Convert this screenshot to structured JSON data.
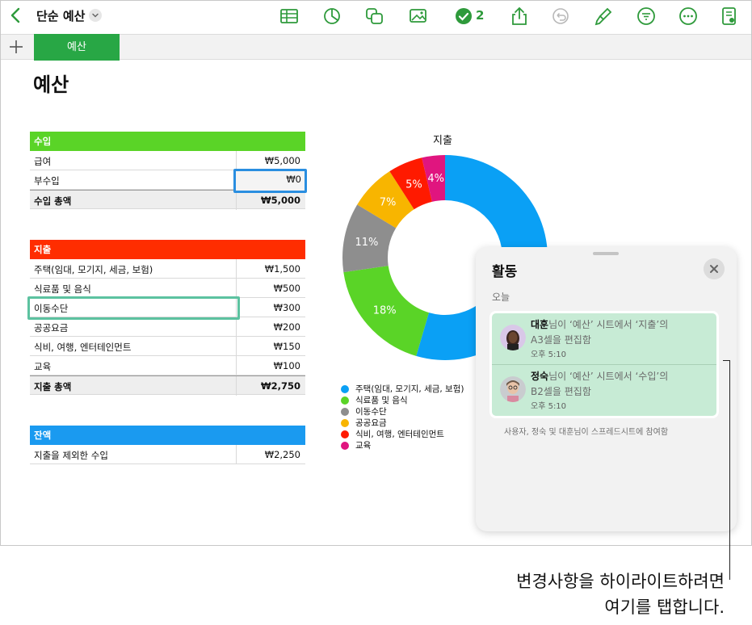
{
  "toolbar": {
    "doc_title": "단순 예산",
    "collab_count": "2"
  },
  "sheet_tabs": [
    {
      "label": "예산"
    }
  ],
  "page_title": "예산",
  "income_table": {
    "header": "수입",
    "header_color": "#5ad427",
    "rows": [
      {
        "label": "급여",
        "value": "₩5,000"
      },
      {
        "label": "부수입",
        "value": "₩0"
      }
    ],
    "total": {
      "label": "수입 총액",
      "value": "₩5,000"
    }
  },
  "expense_table": {
    "header": "지출",
    "header_color": "#ff2d00",
    "rows": [
      {
        "label": "주택(임대, 모기지, 세금, 보험)",
        "value": "₩1,500"
      },
      {
        "label": "식료품 및 음식",
        "value": "₩500"
      },
      {
        "label": "이동수단",
        "value": "₩300"
      },
      {
        "label": "공공요금",
        "value": "₩200"
      },
      {
        "label": "식비, 여행, 엔터테인먼트",
        "value": "₩150"
      },
      {
        "label": "교육",
        "value": "₩100"
      }
    ],
    "total": {
      "label": "지출 총액",
      "value": "₩2,750"
    }
  },
  "balance_table": {
    "header": "잔액",
    "header_color": "#1a9af0",
    "rows": [
      {
        "label": "지출을 제외한 수입",
        "value": "₩2,250"
      }
    ]
  },
  "chart_data": {
    "type": "pie",
    "title": "지출",
    "categories": [
      "주택(임대, 모기지, 세금, 보험)",
      "식료품 및 음식",
      "이동수단",
      "공공요금",
      "식비, 여행, 엔터테인먼트",
      "교육"
    ],
    "values": [
      1500,
      500,
      300,
      200,
      150,
      100
    ],
    "labels": [
      "",
      "18%",
      "11%",
      "7%",
      "5%",
      "4%"
    ],
    "colors": [
      "#0aa0f5",
      "#5ad427",
      "#8e8e8e",
      "#f8b500",
      "#ff1a00",
      "#e0157f"
    ],
    "donut": true,
    "legend_position": "bottom-left"
  },
  "activity": {
    "title": "활동",
    "section": "오늘",
    "items": [
      {
        "user": "대훈",
        "line1": "님이 ‘예산’ 시트에서  ‘지출’의",
        "line2": "A3셀을 편집함",
        "time": "오후 5:10"
      },
      {
        "user": "정숙",
        "line1": "님이 ‘예산’ 시트에서  ‘수입’의",
        "line2": "B2셀을 편집함",
        "time": "오후 5:10"
      }
    ],
    "footer": "사용자, 정숙 및 대훈님이 스프레드시트에 참여함"
  },
  "callout": {
    "line1": "변경사항을 하이라이트하려면",
    "line2": "여기를 탭합니다."
  },
  "accent_color": "#2e9a3b"
}
